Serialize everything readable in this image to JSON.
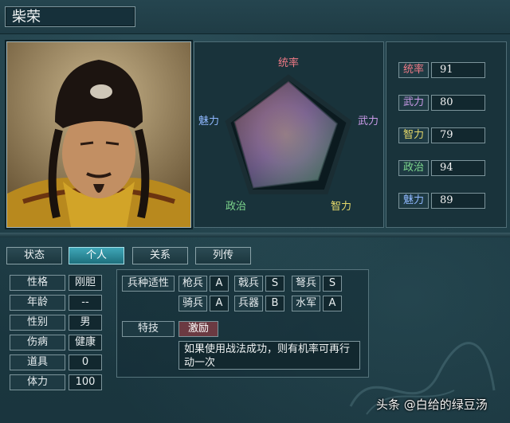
{
  "character": {
    "name": "柴荣"
  },
  "stats": [
    {
      "label": "统率",
      "value": "91",
      "color": "#f07a86"
    },
    {
      "label": "武力",
      "value": "80",
      "color": "#c99ae8"
    },
    {
      "label": "智力",
      "value": "79",
      "color": "#e5d86a"
    },
    {
      "label": "政治",
      "value": "94",
      "color": "#7ed88e"
    },
    {
      "label": "魅力",
      "value": "89",
      "color": "#8fb8ff"
    }
  ],
  "radar": {
    "axes": [
      "统率",
      "武力",
      "智力",
      "政治",
      "魅力"
    ],
    "max": 100
  },
  "tabs": [
    "状态",
    "个人",
    "关系",
    "列传"
  ],
  "active_tab": "个人",
  "personal": [
    {
      "label": "性格",
      "value": "刚胆"
    },
    {
      "label": "年龄",
      "value": "--"
    },
    {
      "label": "性别",
      "value": "男"
    },
    {
      "label": "伤病",
      "value": "健康"
    },
    {
      "label": "道具",
      "value": "0"
    },
    {
      "label": "体力",
      "value": "100"
    }
  ],
  "aptitude": {
    "title": "兵种适性",
    "units": [
      {
        "label": "枪兵",
        "grade": "A"
      },
      {
        "label": "戟兵",
        "grade": "S"
      },
      {
        "label": "弩兵",
        "grade": "S"
      },
      {
        "label": "骑兵",
        "grade": "A"
      },
      {
        "label": "兵器",
        "grade": "B"
      },
      {
        "label": "水军",
        "grade": "A"
      }
    ]
  },
  "skill": {
    "label": "特技",
    "name": "激励",
    "description": "如果使用战法成功，则有机率可再行动一次"
  },
  "watermark": "头条 @白给的绿豆汤"
}
